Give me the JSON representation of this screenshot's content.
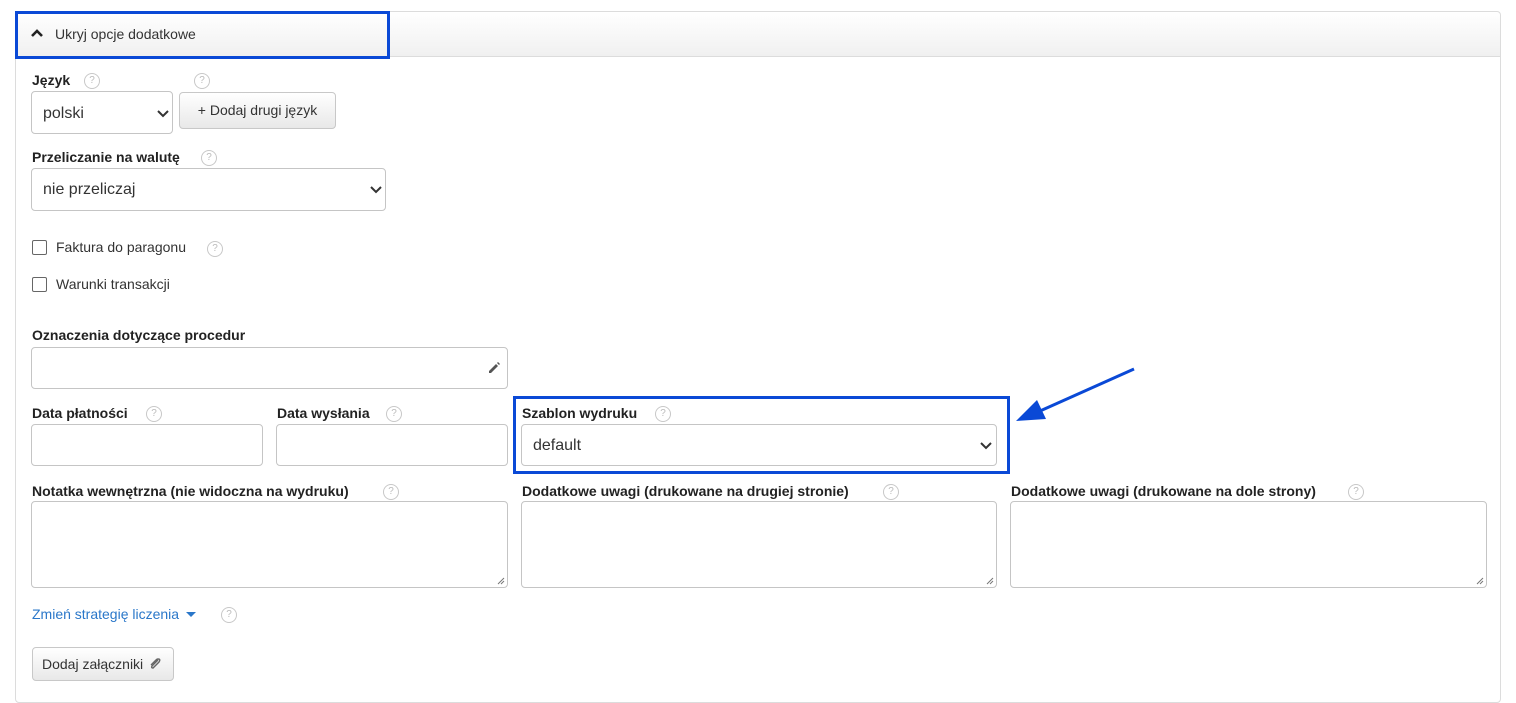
{
  "header": {
    "toggle_label": "Ukryj opcje dodatkowe"
  },
  "language": {
    "label": "Język",
    "value": "polski",
    "add_button": "+ Dodaj drugi język"
  },
  "currency": {
    "label": "Przeliczanie na walutę",
    "value": "nie przeliczaj"
  },
  "checkboxes": {
    "receipt_invoice": "Faktura do paragonu",
    "terms": "Warunki transakcji"
  },
  "procedures": {
    "label": "Oznaczenia dotyczące procedur"
  },
  "payment_date": {
    "label": "Data płatności"
  },
  "shipping_date": {
    "label": "Data wysłania"
  },
  "print_template": {
    "label": "Szablon wydruku",
    "value": "default"
  },
  "notes": {
    "internal": "Notatka wewnętrzna (nie widoczna na wydruku)",
    "second_page": "Dodatkowe uwagi (drukowane na drugiej stronie)",
    "page_bottom": "Dodatkowe uwagi (drukowane na dole strony)"
  },
  "strategy_link": "Zmień strategię liczenia",
  "attachments_button": "Dodaj załączniki",
  "help_symbol": "?",
  "colors": {
    "highlight": "#0a49d6",
    "link": "#2a77c9"
  }
}
